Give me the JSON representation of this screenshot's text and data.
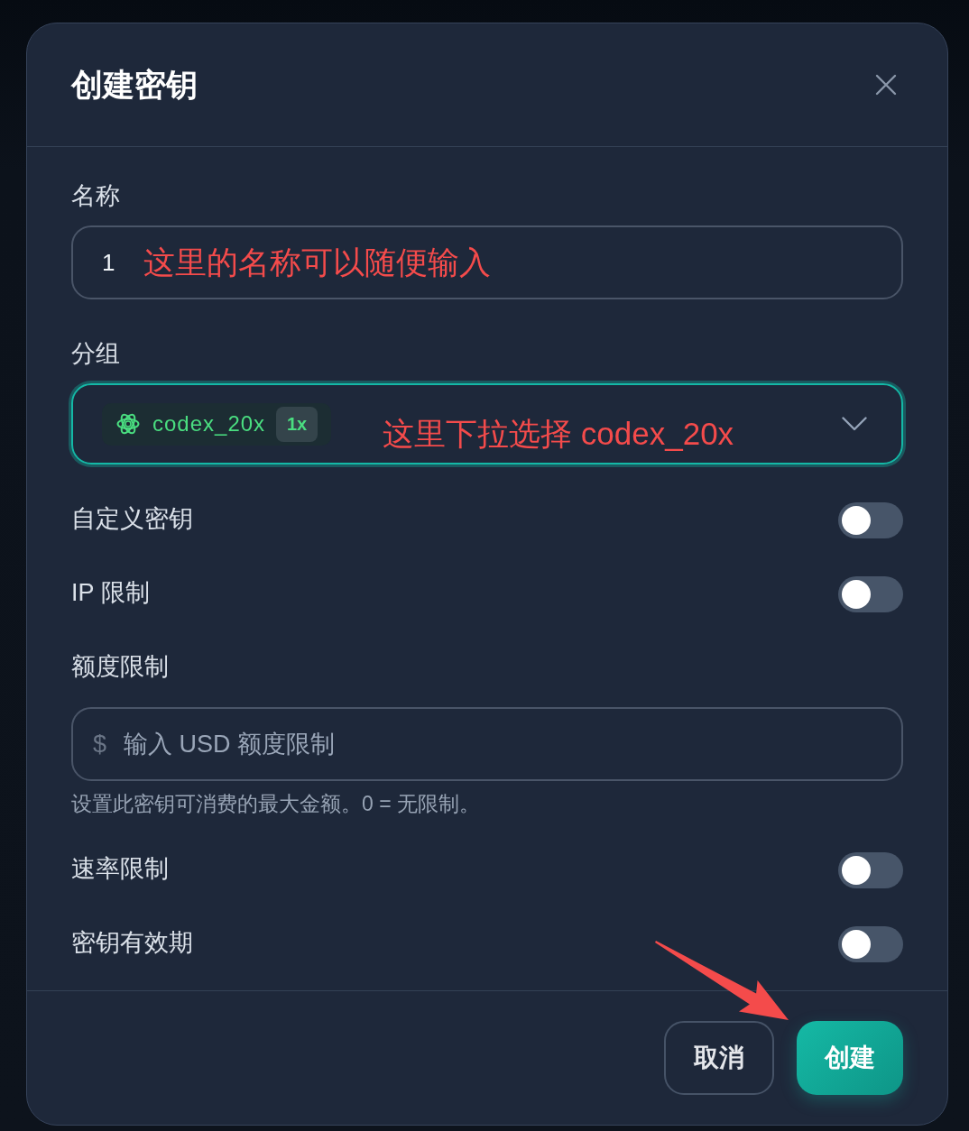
{
  "dialog": {
    "title": "创建密钥"
  },
  "fields": [
    {
      "kind": "text",
      "label": "名称",
      "value": "1",
      "annotation": "这里的名称可以随便输入"
    },
    {
      "kind": "select",
      "label": "分组",
      "focused": true,
      "value": {
        "name": "codex_20x",
        "badge": "1x"
      },
      "annotation": "这里下拉选择 codex_20x"
    },
    {
      "kind": "toggle",
      "label": "自定义密钥",
      "on": false
    },
    {
      "kind": "toggle",
      "label": "IP 限制",
      "on": false
    },
    {
      "kind": "amount",
      "label": "额度限制",
      "prefix": "$",
      "placeholder": "输入 USD 额度限制",
      "help": "设置此密钥可消费的最大金额。0 = 无限制。"
    },
    {
      "kind": "toggle",
      "label": "速率限制",
      "on": false
    },
    {
      "kind": "toggle",
      "label": "密钥有效期",
      "on": false
    }
  ],
  "buttons": [
    {
      "kind": "secondary",
      "label": "取消"
    },
    {
      "kind": "primary",
      "label": "创建"
    }
  ]
}
